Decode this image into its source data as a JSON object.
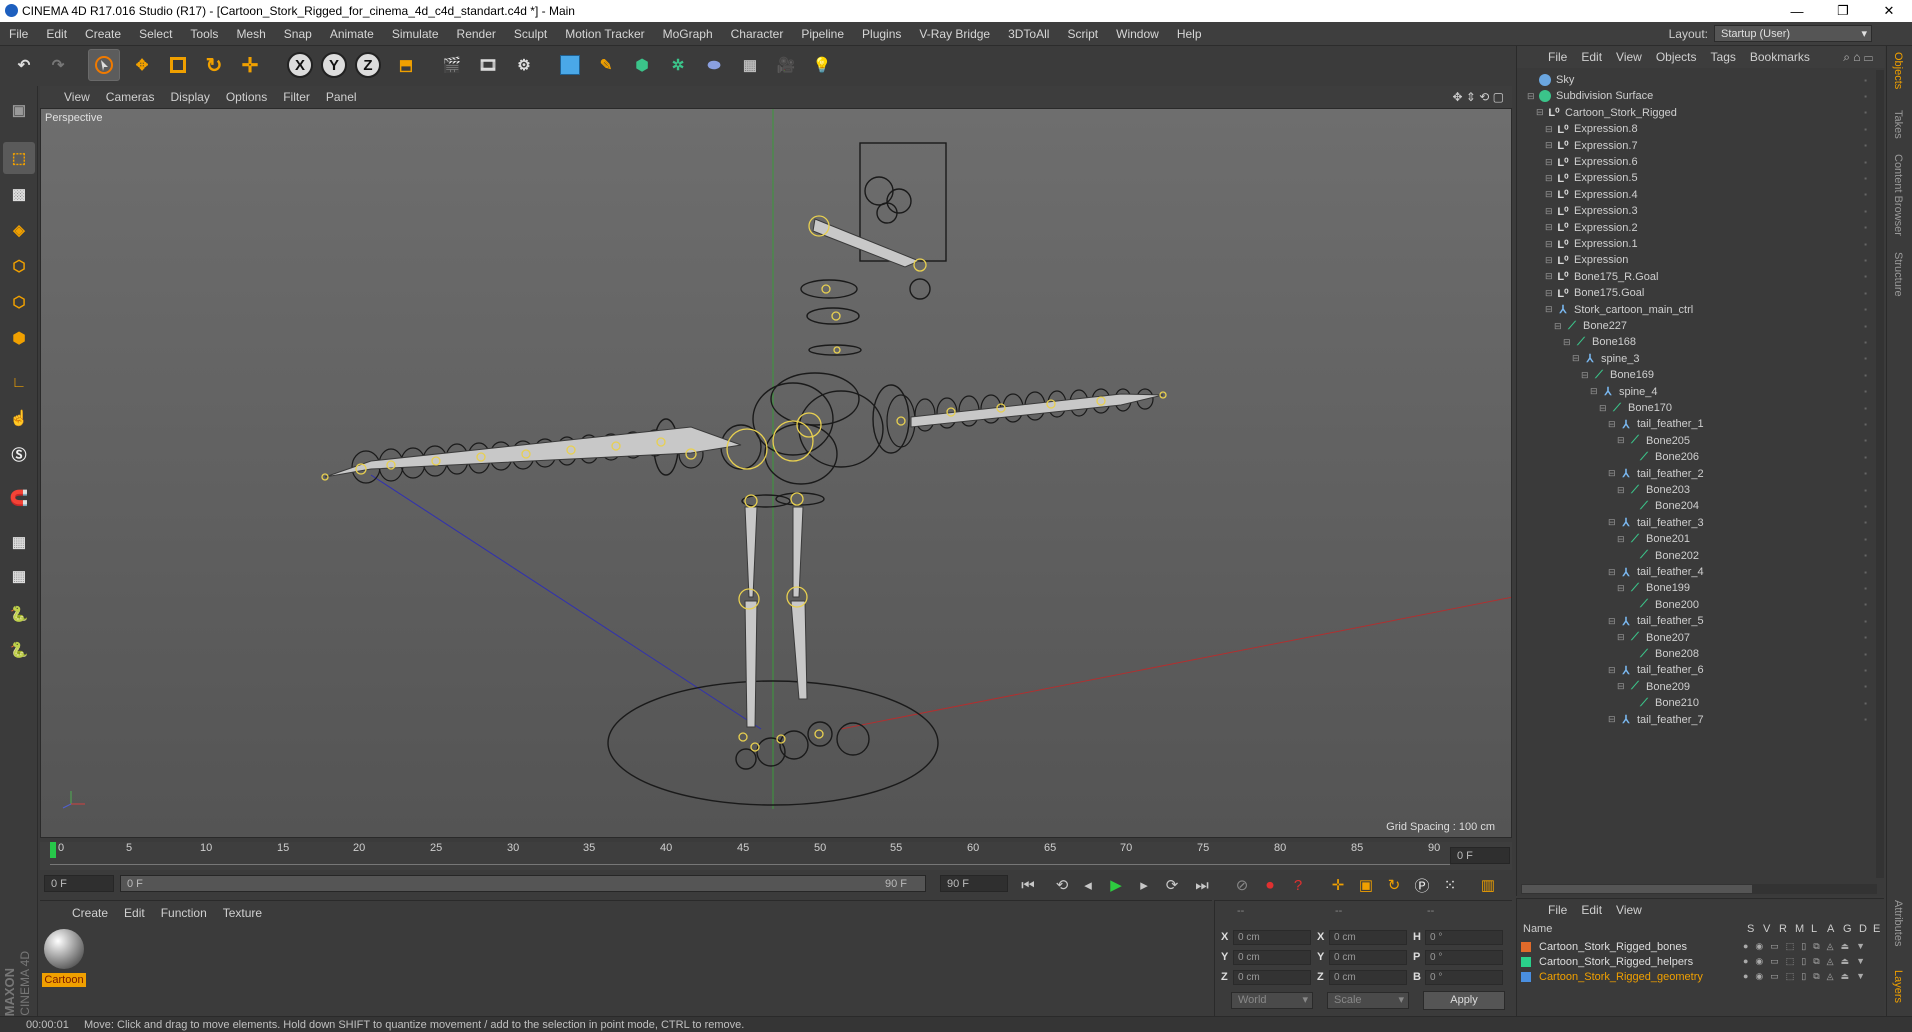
{
  "window": {
    "title": "CINEMA 4D R17.016 Studio (R17) - [Cartoon_Stork_Rigged_for_cinema_4d_c4d_standart.c4d *] - Main"
  },
  "menu": [
    "File",
    "Edit",
    "Create",
    "Select",
    "Tools",
    "Mesh",
    "Snap",
    "Animate",
    "Simulate",
    "Render",
    "Sculpt",
    "Motion Tracker",
    "MoGraph",
    "Character",
    "Pipeline",
    "Plugins",
    "V-Ray Bridge",
    "3DToAll",
    "Script",
    "Window",
    "Help"
  ],
  "layout": {
    "label": "Layout:",
    "value": "Startup (User)"
  },
  "viewport": {
    "menu": [
      "View",
      "Cameras",
      "Display",
      "Options",
      "Filter",
      "Panel"
    ],
    "label": "Perspective",
    "grid_spacing": "Grid Spacing : 100 cm"
  },
  "timeline": {
    "ticks": [
      "0",
      "5",
      "10",
      "15",
      "20",
      "25",
      "30",
      "35",
      "40",
      "45",
      "50",
      "55",
      "60",
      "65",
      "70",
      "75",
      "80",
      "85",
      "90"
    ],
    "current_frame": "0 F"
  },
  "transport": {
    "start": "0 F",
    "range_start": "0 F",
    "range_end": "90 F",
    "end": "90 F"
  },
  "material_panel": {
    "menu": [
      "Create",
      "Edit",
      "Function",
      "Texture"
    ],
    "material_name": "Cartoon"
  },
  "coordinates": {
    "header": [
      "--",
      "--",
      "--"
    ],
    "pos_labels": [
      "X",
      "Y",
      "Z"
    ],
    "size_labels": [
      "X",
      "Y",
      "Z"
    ],
    "rot_labels": [
      "H",
      "P",
      "B"
    ],
    "pos": [
      "0 cm",
      "0 cm",
      "0 cm"
    ],
    "size": [
      "0 cm",
      "0 cm",
      "0 cm"
    ],
    "rot": [
      "0 °",
      "0 °",
      "0 °"
    ],
    "world": "World",
    "scale": "Scale",
    "apply": "Apply"
  },
  "object_manager": {
    "menu": [
      "File",
      "Edit",
      "View",
      "Objects",
      "Tags",
      "Bookmarks"
    ],
    "objects": [
      {
        "name": "Sky",
        "indent": 0,
        "icon": "sky-icon"
      },
      {
        "name": "Subdivision Surface",
        "indent": 0,
        "icon": "subdivision-icon"
      },
      {
        "name": "Cartoon_Stork_Rigged",
        "indent": 1,
        "icon": "null-icon"
      },
      {
        "name": "Expression.8",
        "indent": 2,
        "icon": "null-icon"
      },
      {
        "name": "Expression.7",
        "indent": 2,
        "icon": "null-icon"
      },
      {
        "name": "Expression.6",
        "indent": 2,
        "icon": "null-icon"
      },
      {
        "name": "Expression.5",
        "indent": 2,
        "icon": "null-icon"
      },
      {
        "name": "Expression.4",
        "indent": 2,
        "icon": "null-icon"
      },
      {
        "name": "Expression.3",
        "indent": 2,
        "icon": "null-icon"
      },
      {
        "name": "Expression.2",
        "indent": 2,
        "icon": "null-icon"
      },
      {
        "name": "Expression.1",
        "indent": 2,
        "icon": "null-icon"
      },
      {
        "name": "Expression",
        "indent": 2,
        "icon": "null-icon"
      },
      {
        "name": "Bone175_R.Goal",
        "indent": 2,
        "icon": "null-icon"
      },
      {
        "name": "Bone175.Goal",
        "indent": 2,
        "icon": "null-icon"
      },
      {
        "name": "Stork_cartoon_main_ctrl",
        "indent": 2,
        "icon": "joint-icon"
      },
      {
        "name": "Bone227",
        "indent": 3,
        "icon": "bone-icon"
      },
      {
        "name": "Bone168",
        "indent": 4,
        "icon": "bone-icon"
      },
      {
        "name": "spine_3",
        "indent": 5,
        "icon": "joint-icon"
      },
      {
        "name": "Bone169",
        "indent": 6,
        "icon": "bone-icon"
      },
      {
        "name": "spine_4",
        "indent": 7,
        "icon": "joint-icon"
      },
      {
        "name": "Bone170",
        "indent": 8,
        "icon": "bone-icon"
      },
      {
        "name": "tail_feather_1",
        "indent": 9,
        "icon": "joint-icon"
      },
      {
        "name": "Bone205",
        "indent": 10,
        "icon": "bone-icon"
      },
      {
        "name": "Bone206",
        "indent": 11,
        "icon": "bone-icon"
      },
      {
        "name": "tail_feather_2",
        "indent": 9,
        "icon": "joint-icon"
      },
      {
        "name": "Bone203",
        "indent": 10,
        "icon": "bone-icon"
      },
      {
        "name": "Bone204",
        "indent": 11,
        "icon": "bone-icon"
      },
      {
        "name": "tail_feather_3",
        "indent": 9,
        "icon": "joint-icon"
      },
      {
        "name": "Bone201",
        "indent": 10,
        "icon": "bone-icon"
      },
      {
        "name": "Bone202",
        "indent": 11,
        "icon": "bone-icon"
      },
      {
        "name": "tail_feather_4",
        "indent": 9,
        "icon": "joint-icon"
      },
      {
        "name": "Bone199",
        "indent": 10,
        "icon": "bone-icon"
      },
      {
        "name": "Bone200",
        "indent": 11,
        "icon": "bone-icon"
      },
      {
        "name": "tail_feather_5",
        "indent": 9,
        "icon": "joint-icon"
      },
      {
        "name": "Bone207",
        "indent": 10,
        "icon": "bone-icon"
      },
      {
        "name": "Bone208",
        "indent": 11,
        "icon": "bone-icon"
      },
      {
        "name": "tail_feather_6",
        "indent": 9,
        "icon": "joint-icon"
      },
      {
        "name": "Bone209",
        "indent": 10,
        "icon": "bone-icon"
      },
      {
        "name": "Bone210",
        "indent": 11,
        "icon": "bone-icon"
      },
      {
        "name": "tail_feather_7",
        "indent": 9,
        "icon": "joint-icon"
      }
    ]
  },
  "layer_manager": {
    "menu": [
      "File",
      "Edit",
      "View"
    ],
    "columns": [
      "Name",
      "S",
      "V",
      "R",
      "M",
      "L",
      "A",
      "G",
      "D",
      "E"
    ],
    "layers": [
      {
        "name": "Cartoon_Stork_Rigged_bones",
        "color": "#e06a2a",
        "highlight": false
      },
      {
        "name": "Cartoon_Stork_Rigged_helpers",
        "color": "#2ad08a",
        "highlight": false
      },
      {
        "name": "Cartoon_Stork_Rigged_geometry",
        "color": "#4a8fe0",
        "highlight": true
      }
    ]
  },
  "side_tabs": [
    "Objects",
    "Takes",
    "Content Browser",
    "Structure",
    "Attributes",
    "Layers"
  ],
  "status": {
    "time": "00:00:01",
    "message": "Move: Click and drag to move elements. Hold down SHIFT to quantize movement / add to the selection in point mode, CTRL to remove."
  },
  "brand": {
    "line1": "MAXON",
    "line2": "CINEMA 4D"
  },
  "colors": {
    "accent": "#f0a000",
    "bg": "#3b3b3b"
  }
}
